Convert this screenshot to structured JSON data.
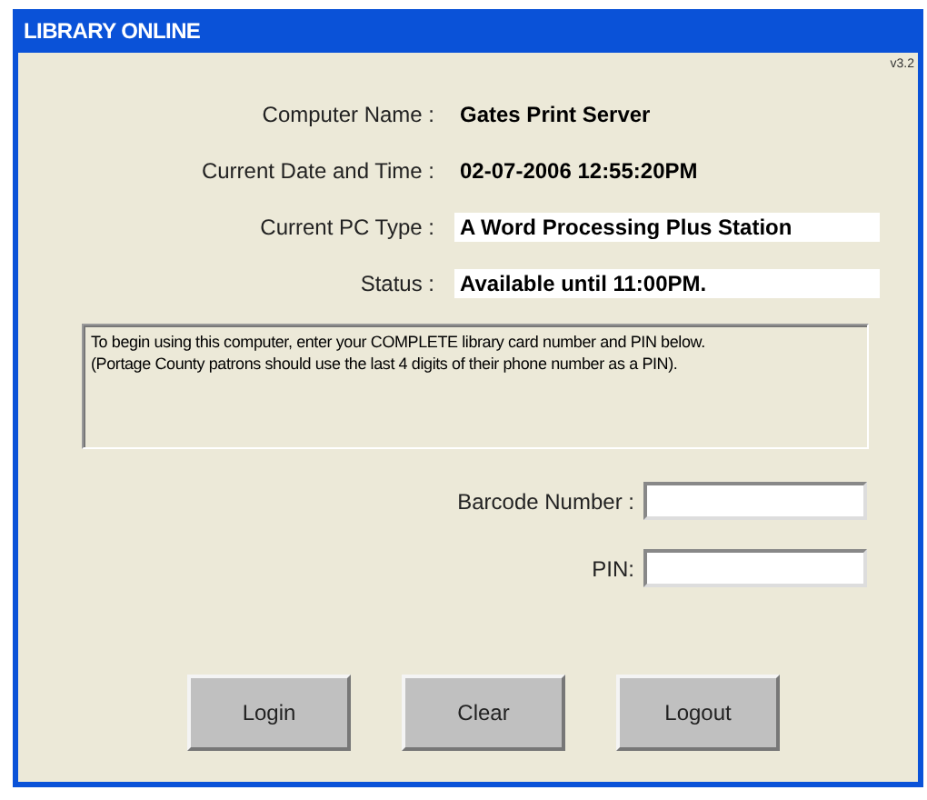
{
  "window": {
    "title": "LIBRARY ONLINE"
  },
  "version": "v3.2",
  "info": [
    {
      "label": "Computer Name :",
      "value": "Gates Print Server",
      "boxed": false
    },
    {
      "label": "Current Date and Time :",
      "value": "02-07-2006 12:55:20PM",
      "boxed": false
    },
    {
      "label": "Current PC Type :",
      "value": "A Word Processing Plus Station",
      "boxed": true
    },
    {
      "label": "Status :",
      "value": "Available until 11:00PM.",
      "boxed": true
    }
  ],
  "message": [
    "To begin using this computer, enter your COMPLETE library card number and PIN below.",
    "(Portage County patrons should use the last 4 digits of their phone number as a PIN)."
  ],
  "fields": [
    {
      "label": "Barcode Number :"
    },
    {
      "label": "PIN:"
    }
  ],
  "buttons": [
    "Login",
    "Clear",
    "Logout"
  ]
}
